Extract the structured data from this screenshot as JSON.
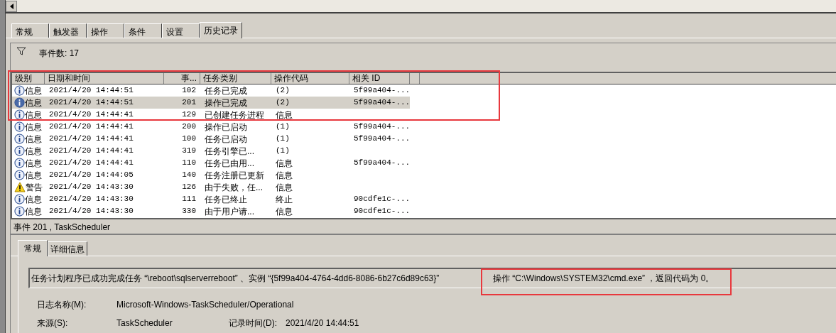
{
  "tabs": [
    {
      "label": "常规",
      "selected": false
    },
    {
      "label": "触发器",
      "selected": false
    },
    {
      "label": "操作",
      "selected": false
    },
    {
      "label": "条件",
      "selected": false
    },
    {
      "label": "设置",
      "selected": false
    },
    {
      "label": "历史记录",
      "selected": true
    }
  ],
  "filter": {
    "label": "事件数: 17"
  },
  "table": {
    "columns": [
      "级别",
      "日期和时间",
      "事...",
      "任务类别",
      "操作代码",
      "相关 ID"
    ],
    "rows": [
      {
        "kind": "info",
        "selected": false,
        "cells": [
          "信息",
          "2021/4/20 14:44:51",
          "102",
          "任务已完成",
          "(2)",
          "5f99a404-..."
        ]
      },
      {
        "kind": "info",
        "selected": true,
        "cells": [
          "信息",
          "2021/4/20 14:44:51",
          "201",
          "操作已完成",
          "(2)",
          "5f99a404-..."
        ]
      },
      {
        "kind": "info",
        "selected": false,
        "cells": [
          "信息",
          "2021/4/20 14:44:41",
          "129",
          "已创建任务进程",
          "信息",
          ""
        ]
      },
      {
        "kind": "info",
        "selected": false,
        "cells": [
          "信息",
          "2021/4/20 14:44:41",
          "200",
          "操作已启动",
          "(1)",
          "5f99a404-..."
        ]
      },
      {
        "kind": "info",
        "selected": false,
        "cells": [
          "信息",
          "2021/4/20 14:44:41",
          "100",
          "任务已启动",
          "(1)",
          "5f99a404-..."
        ]
      },
      {
        "kind": "info",
        "selected": false,
        "cells": [
          "信息",
          "2021/4/20 14:44:41",
          "319",
          "任务引擎已...",
          "(1)",
          ""
        ]
      },
      {
        "kind": "info",
        "selected": false,
        "cells": [
          "信息",
          "2021/4/20 14:44:41",
          "110",
          "任务已由用...",
          "信息",
          "5f99a404-..."
        ]
      },
      {
        "kind": "info",
        "selected": false,
        "cells": [
          "信息",
          "2021/4/20 14:44:05",
          "140",
          "任务注册已更新",
          "信息",
          ""
        ]
      },
      {
        "kind": "warning",
        "selected": false,
        "cells": [
          "警告",
          "2021/4/20 14:43:30",
          "126",
          "由于失败，任...",
          "信息",
          ""
        ]
      },
      {
        "kind": "info",
        "selected": false,
        "cells": [
          "信息",
          "2021/4/20 14:43:30",
          "111",
          "任务已终止",
          "终止",
          "90cdfe1c-..."
        ]
      },
      {
        "kind": "info",
        "selected": false,
        "cells": [
          "信息",
          "2021/4/20 14:43:30",
          "330",
          "由于用户请...",
          "信息",
          "90cdfe1c-..."
        ]
      }
    ]
  },
  "detail": {
    "title": "事件 201 , TaskScheduler",
    "tabs": [
      {
        "label": "常规",
        "selected": true
      },
      {
        "label": "详细信息",
        "selected": false
      }
    ],
    "message": [
      "任务计划程序已成功完成任务 “\\reboot\\sqlserverreboot” 、实例 “{5f99a404-4764-4dd6-8086-6b27c6d89c63}”",
      "操作 “C:\\Windows\\SYSTEM32\\cmd.exe” ，返回代码为 0。"
    ],
    "log_name": {
      "label": "日志名称(M):",
      "value": "Microsoft-Windows-TaskScheduler/Operational"
    },
    "source": {
      "label": "来源(S):",
      "value": "TaskScheduler"
    },
    "logged": {
      "label": "记录时间(D):",
      "value": "2021/4/20 14:44:51"
    }
  }
}
